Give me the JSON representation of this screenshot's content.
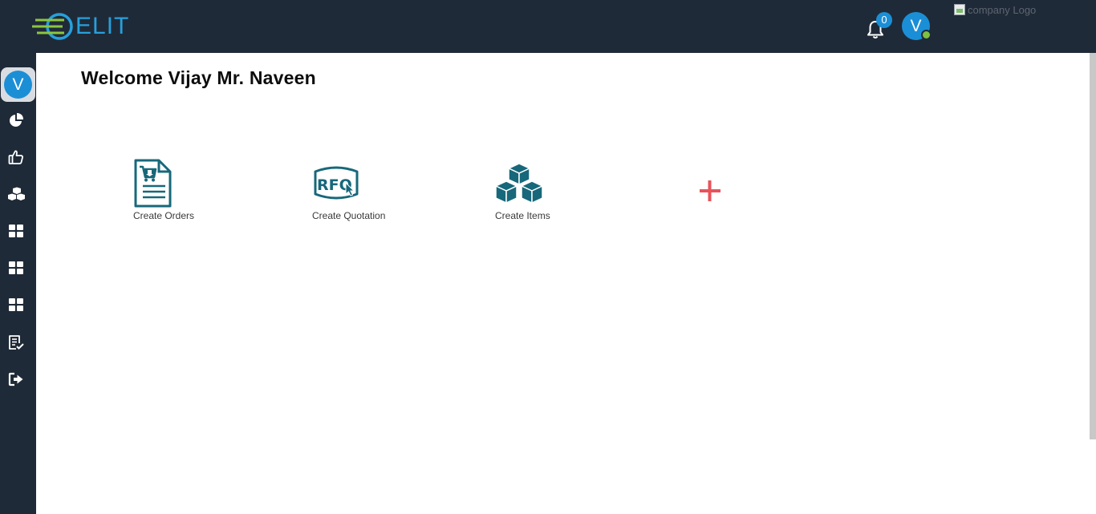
{
  "header": {
    "logo_text": "ELIT",
    "notification_count": "0",
    "user_initial": "V",
    "company_logo_alt": "company Logo"
  },
  "sidebar": {
    "user_initial": "V",
    "items": [
      {
        "icon": "pie-chart-icon"
      },
      {
        "icon": "thumbs-up-icon"
      },
      {
        "icon": "boxes-icon"
      },
      {
        "icon": "grid-icon"
      },
      {
        "icon": "grid-icon"
      },
      {
        "icon": "grid-icon"
      },
      {
        "icon": "checklist-icon"
      },
      {
        "icon": "logout-icon"
      }
    ]
  },
  "main": {
    "welcome": "Welcome Vijay Mr. Naveen",
    "tiles": [
      {
        "label": "Create Orders",
        "icon": "order-document-icon"
      },
      {
        "label": "Create Quotation",
        "icon": "rfq-icon"
      },
      {
        "label": "Create Items",
        "icon": "cubes-icon"
      }
    ],
    "add_icon": "plus-icon"
  },
  "colors": {
    "topbar": "#1f2a38",
    "accent_blue": "#1b8fd6",
    "icon_teal": "#17687a",
    "add_red": "#e8535a",
    "online_green": "#7dc142"
  }
}
